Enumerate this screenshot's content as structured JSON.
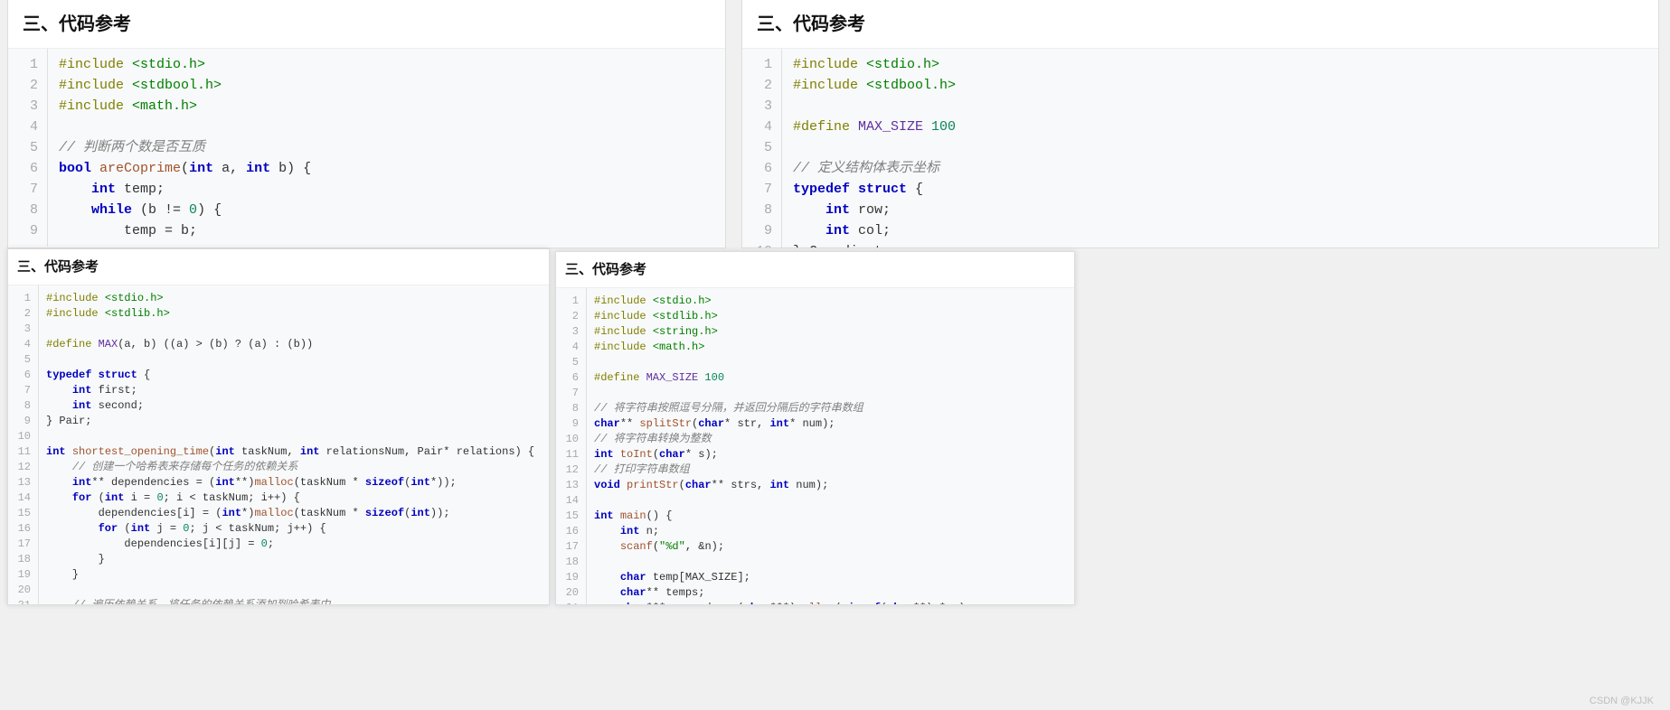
{
  "watermark": "CSDN @KJJK",
  "panels": {
    "p1": {
      "heading": "三、代码参考",
      "lines": [
        [
          {
            "c": "pp",
            "t": "#include "
          },
          {
            "c": "str",
            "t": "<stdio.h>"
          }
        ],
        [
          {
            "c": "pp",
            "t": "#include "
          },
          {
            "c": "str",
            "t": "<stdbool.h>"
          }
        ],
        [
          {
            "c": "pp",
            "t": "#include "
          },
          {
            "c": "str",
            "t": "<math.h>"
          }
        ],
        [],
        [
          {
            "c": "cm",
            "t": "// 判断两个数是否互质"
          }
        ],
        [
          {
            "c": "kw",
            "t": "bool"
          },
          {
            "t": " "
          },
          {
            "c": "fn",
            "t": "areCoprime"
          },
          {
            "t": "("
          },
          {
            "c": "kw",
            "t": "int"
          },
          {
            "t": " a, "
          },
          {
            "c": "kw",
            "t": "int"
          },
          {
            "t": " b) {"
          }
        ],
        [
          {
            "t": "    "
          },
          {
            "c": "kw",
            "t": "int"
          },
          {
            "t": " temp;"
          }
        ],
        [
          {
            "t": "    "
          },
          {
            "c": "kw",
            "t": "while"
          },
          {
            "t": " (b != "
          },
          {
            "c": "num",
            "t": "0"
          },
          {
            "t": ") {"
          }
        ],
        [
          {
            "t": "        temp = b;"
          }
        ]
      ]
    },
    "p2": {
      "heading": "三、代码参考",
      "lines": [
        [
          {
            "c": "pp",
            "t": "#include "
          },
          {
            "c": "str",
            "t": "<stdio.h>"
          }
        ],
        [
          {
            "c": "pp",
            "t": "#include "
          },
          {
            "c": "str",
            "t": "<stdbool.h>"
          }
        ],
        [],
        [
          {
            "c": "pp",
            "t": "#define "
          },
          {
            "c": "mac",
            "t": "MAX_SIZE"
          },
          {
            "t": " "
          },
          {
            "c": "num",
            "t": "100"
          }
        ],
        [],
        [
          {
            "c": "cm",
            "t": "// 定义结构体表示坐标"
          }
        ],
        [
          {
            "c": "kw",
            "t": "typedef"
          },
          {
            "t": " "
          },
          {
            "c": "kw",
            "t": "struct"
          },
          {
            "t": " {"
          }
        ],
        [
          {
            "t": "    "
          },
          {
            "c": "kw",
            "t": "int"
          },
          {
            "t": " row;"
          }
        ],
        [
          {
            "t": "    "
          },
          {
            "c": "kw",
            "t": "int"
          },
          {
            "t": " col;"
          }
        ],
        [
          {
            "t": "} Coordinate;"
          }
        ],
        []
      ]
    },
    "p3": {
      "heading": "三、代码参考",
      "lines": [
        [
          {
            "c": "pp",
            "t": "#include "
          },
          {
            "c": "str",
            "t": "<stdio.h>"
          }
        ],
        [
          {
            "c": "pp",
            "t": "#include "
          },
          {
            "c": "str",
            "t": "<stdlib.h>"
          }
        ],
        [],
        [
          {
            "c": "pp",
            "t": "#define "
          },
          {
            "c": "mac",
            "t": "MAX"
          },
          {
            "t": "(a, b) ((a) > (b) ? (a) : (b))"
          }
        ],
        [],
        [
          {
            "c": "kw",
            "t": "typedef"
          },
          {
            "t": " "
          },
          {
            "c": "kw",
            "t": "struct"
          },
          {
            "t": " {"
          }
        ],
        [
          {
            "t": "    "
          },
          {
            "c": "kw",
            "t": "int"
          },
          {
            "t": " first;"
          }
        ],
        [
          {
            "t": "    "
          },
          {
            "c": "kw",
            "t": "int"
          },
          {
            "t": " second;"
          }
        ],
        [
          {
            "t": "} Pair;"
          }
        ],
        [],
        [
          {
            "c": "kw",
            "t": "int"
          },
          {
            "t": " "
          },
          {
            "c": "fn",
            "t": "shortest_opening_time"
          },
          {
            "t": "("
          },
          {
            "c": "kw",
            "t": "int"
          },
          {
            "t": " taskNum, "
          },
          {
            "c": "kw",
            "t": "int"
          },
          {
            "t": " relationsNum, Pair* relations) {"
          }
        ],
        [
          {
            "t": "    "
          },
          {
            "c": "cm",
            "t": "// 创建一个哈希表来存储每个任务的依赖关系"
          }
        ],
        [
          {
            "t": "    "
          },
          {
            "c": "kw",
            "t": "int"
          },
          {
            "t": "** dependencies = ("
          },
          {
            "c": "kw",
            "t": "int"
          },
          {
            "t": "**)"
          },
          {
            "c": "fn",
            "t": "malloc"
          },
          {
            "t": "(taskNum * "
          },
          {
            "c": "kw",
            "t": "sizeof"
          },
          {
            "t": "("
          },
          {
            "c": "kw",
            "t": "int"
          },
          {
            "t": "*));"
          }
        ],
        [
          {
            "t": "    "
          },
          {
            "c": "kw",
            "t": "for"
          },
          {
            "t": " ("
          },
          {
            "c": "kw",
            "t": "int"
          },
          {
            "t": " i = "
          },
          {
            "c": "num",
            "t": "0"
          },
          {
            "t": "; i < taskNum; i++) {"
          }
        ],
        [
          {
            "t": "        dependencies[i] = ("
          },
          {
            "c": "kw",
            "t": "int"
          },
          {
            "t": "*)"
          },
          {
            "c": "fn",
            "t": "malloc"
          },
          {
            "t": "(taskNum * "
          },
          {
            "c": "kw",
            "t": "sizeof"
          },
          {
            "t": "("
          },
          {
            "c": "kw",
            "t": "int"
          },
          {
            "t": "));"
          }
        ],
        [
          {
            "t": "        "
          },
          {
            "c": "kw",
            "t": "for"
          },
          {
            "t": " ("
          },
          {
            "c": "kw",
            "t": "int"
          },
          {
            "t": " j = "
          },
          {
            "c": "num",
            "t": "0"
          },
          {
            "t": "; j < taskNum; j++) {"
          }
        ],
        [
          {
            "t": "            dependencies[i][j] = "
          },
          {
            "c": "num",
            "t": "0"
          },
          {
            "t": ";"
          }
        ],
        [
          {
            "t": "        }"
          }
        ],
        [
          {
            "t": "    }"
          }
        ],
        [],
        [
          {
            "t": "    "
          },
          {
            "c": "cm",
            "t": "// 遍历依赖关系，将任务的依赖关系添加到哈希表中"
          }
        ]
      ]
    },
    "p4": {
      "heading": "三、代码参考",
      "lines": [
        [
          {
            "c": "pp",
            "t": "#include "
          },
          {
            "c": "str",
            "t": "<stdio.h>"
          }
        ],
        [
          {
            "c": "pp",
            "t": "#include "
          },
          {
            "c": "str",
            "t": "<stdlib.h>"
          }
        ],
        [
          {
            "c": "pp",
            "t": "#include "
          },
          {
            "c": "str",
            "t": "<string.h>"
          }
        ],
        [
          {
            "c": "pp",
            "t": "#include "
          },
          {
            "c": "str",
            "t": "<math.h>"
          }
        ],
        [],
        [
          {
            "c": "pp",
            "t": "#define "
          },
          {
            "c": "mac",
            "t": "MAX_SIZE"
          },
          {
            "t": " "
          },
          {
            "c": "num",
            "t": "100"
          }
        ],
        [],
        [
          {
            "c": "cm",
            "t": "// 将字符串按照逗号分隔，并返回分隔后的字符串数组"
          }
        ],
        [
          {
            "c": "kw",
            "t": "char"
          },
          {
            "t": "** "
          },
          {
            "c": "fn",
            "t": "splitStr"
          },
          {
            "t": "("
          },
          {
            "c": "kw",
            "t": "char"
          },
          {
            "t": "* str, "
          },
          {
            "c": "kw",
            "t": "int"
          },
          {
            "t": "* num);"
          }
        ],
        [
          {
            "c": "cm",
            "t": "// 将字符串转换为整数"
          }
        ],
        [
          {
            "c": "kw",
            "t": "int"
          },
          {
            "t": " "
          },
          {
            "c": "fn",
            "t": "toInt"
          },
          {
            "t": "("
          },
          {
            "c": "kw",
            "t": "char"
          },
          {
            "t": "* s);"
          }
        ],
        [
          {
            "c": "cm",
            "t": "// 打印字符串数组"
          }
        ],
        [
          {
            "c": "kw",
            "t": "void"
          },
          {
            "t": " "
          },
          {
            "c": "fn",
            "t": "printStr"
          },
          {
            "t": "("
          },
          {
            "c": "kw",
            "t": "char"
          },
          {
            "t": "** strs, "
          },
          {
            "c": "kw",
            "t": "int"
          },
          {
            "t": " num);"
          }
        ],
        [],
        [
          {
            "c": "kw",
            "t": "int"
          },
          {
            "t": " "
          },
          {
            "c": "fn",
            "t": "main"
          },
          {
            "t": "() {"
          }
        ],
        [
          {
            "t": "    "
          },
          {
            "c": "kw",
            "t": "int"
          },
          {
            "t": " n;"
          }
        ],
        [
          {
            "t": "    "
          },
          {
            "c": "fn",
            "t": "scanf"
          },
          {
            "t": "("
          },
          {
            "c": "str",
            "t": "\"%d\""
          },
          {
            "t": ", &n);"
          }
        ],
        [],
        [
          {
            "t": "    "
          },
          {
            "c": "kw",
            "t": "char"
          },
          {
            "t": " temp[MAX_SIZE];"
          }
        ],
        [
          {
            "t": "    "
          },
          {
            "c": "kw",
            "t": "char"
          },
          {
            "t": "** temps;"
          }
        ],
        [
          {
            "t": "    "
          },
          {
            "c": "kw",
            "t": "char"
          },
          {
            "t": "*** records = ("
          },
          {
            "c": "kw",
            "t": "char"
          },
          {
            "t": "***)"
          },
          {
            "c": "fn",
            "t": "malloc"
          },
          {
            "t": "("
          },
          {
            "c": "kw",
            "t": "sizeof"
          },
          {
            "t": "("
          },
          {
            "c": "kw",
            "t": "char"
          },
          {
            "t": "**) * n);"
          }
        ]
      ]
    }
  }
}
